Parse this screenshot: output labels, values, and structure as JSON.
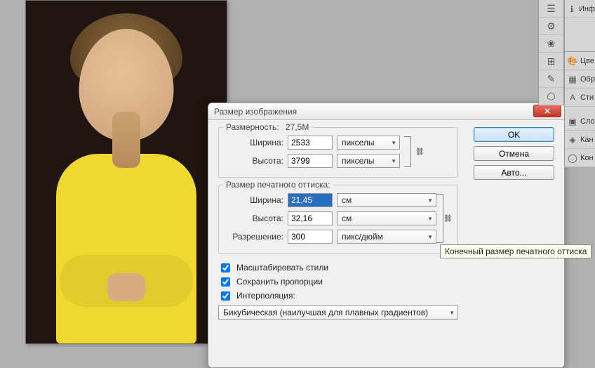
{
  "canvas": {
    "description": "Portrait photo of a boy in yellow t-shirt"
  },
  "dialog": {
    "title": "Размер изображения",
    "close_label": "✕",
    "pixel_dimensions": {
      "heading": "Размерность:",
      "size_value": "27,5M",
      "width_label": "Ширина:",
      "width_value": "2533",
      "width_unit": "пикселы",
      "height_label": "Высота:",
      "height_value": "3799",
      "height_unit": "пикселы"
    },
    "document_size": {
      "heading": "Размер печатного оттиска:",
      "width_label": "Ширина:",
      "width_value": "21,45",
      "width_unit": "см",
      "height_label": "Высота:",
      "height_value": "32,16",
      "height_unit": "см",
      "resolution_label": "Разрешение:",
      "resolution_value": "300",
      "resolution_unit": "пикс/дюйм"
    },
    "checkboxes": {
      "scale_styles": "Масштабировать стили",
      "constrain_proportions": "Сохранить пропорции",
      "resample": "Интерполяция:"
    },
    "interpolation_method": "Бикубическая (наилучшая для плавных градиентов)",
    "buttons": {
      "ok": "OK",
      "cancel": "Отмена",
      "auto": "Авто..."
    },
    "tooltip": "Конечный размер печатного оттиска"
  },
  "panels": {
    "items": [
      {
        "icon": "ℹ",
        "label": "Инф"
      },
      {
        "icon": "🎨",
        "label": "Цве"
      },
      {
        "icon": "▦",
        "label": "Обр"
      },
      {
        "icon": "A",
        "label": "Сти"
      },
      {
        "icon": "▣",
        "label": "Сло"
      },
      {
        "icon": "◈",
        "label": "Кан"
      },
      {
        "icon": "◯",
        "label": "Кон"
      }
    ],
    "toolbar_icons": [
      "☰",
      "⚙",
      "❀",
      "⊞",
      "✎",
      "⬡"
    ]
  }
}
